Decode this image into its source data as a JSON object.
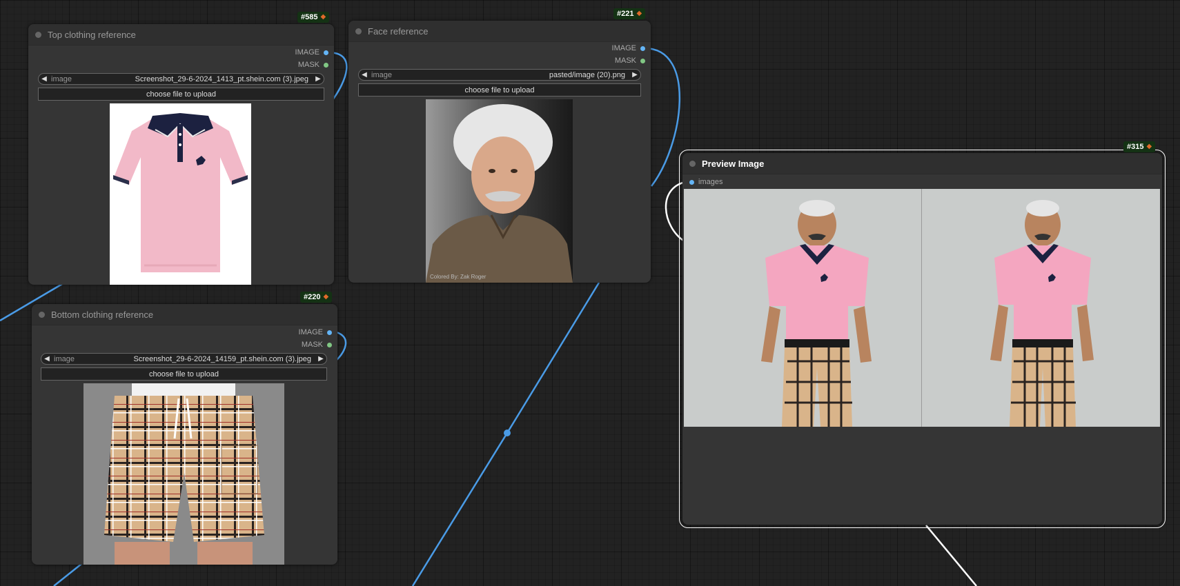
{
  "nodes": {
    "top_clothing": {
      "id": "#585",
      "title": "Top clothing reference",
      "outputs": [
        "IMAGE",
        "MASK"
      ],
      "widget_label": "image",
      "widget_value": "Screenshot_29-6-2024_1413_pt.shein.com (3).jpeg",
      "upload_label": "choose file to upload"
    },
    "face": {
      "id": "#221",
      "title": "Face reference",
      "outputs": [
        "IMAGE",
        "MASK"
      ],
      "widget_label": "image",
      "widget_value": "pasted/image (20).png",
      "upload_label": "choose file to upload",
      "watermark": "Colored By: Zak Roger"
    },
    "bottom_clothing": {
      "id": "#220",
      "title": "Bottom clothing reference",
      "outputs": [
        "IMAGE",
        "MASK"
      ],
      "widget_label": "image",
      "widget_value": "Screenshot_29-6-2024_14159_pt.shein.com (3).jpeg",
      "upload_label": "choose file to upload"
    },
    "preview": {
      "id": "#315",
      "title": "Preview Image",
      "input": "images"
    }
  },
  "colors": {
    "image_slot": "#64b5f6",
    "mask_slot": "#81c784",
    "link": "#4a9be6",
    "badge_bg": "#143214",
    "node_bg": "#353535"
  }
}
